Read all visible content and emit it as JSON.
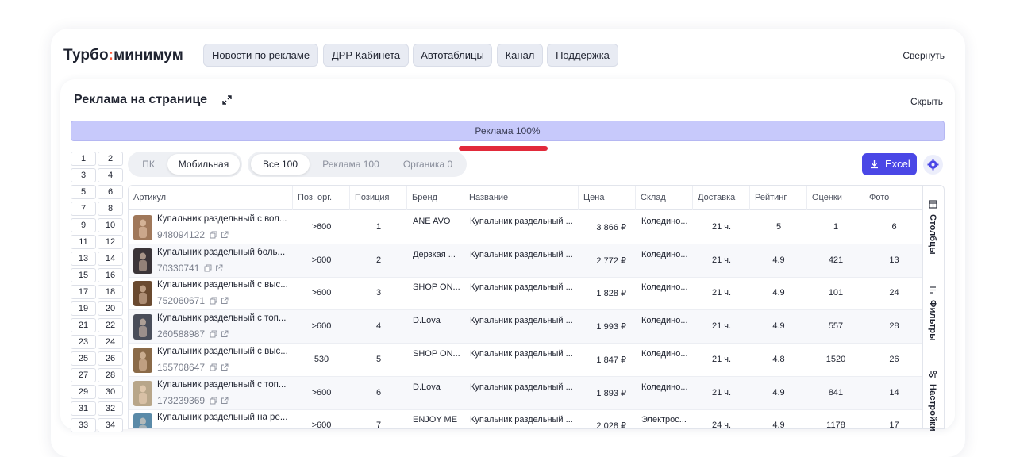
{
  "header": {
    "logo_part1": "Турбо",
    "logo_colon": ":",
    "logo_part2": "минимум",
    "nav": [
      "Новости по рекламе",
      "ДРР Кабинета",
      "Автотаблицы",
      "Канал",
      "Поддержка"
    ],
    "collapse_label": "Свернуть"
  },
  "section": {
    "title": "Реклама на странице",
    "hide_label": "Скрыть",
    "ad_bar_label": "Реклама 100%"
  },
  "positions": [
    "1",
    "2",
    "3",
    "4",
    "5",
    "6",
    "7",
    "8",
    "9",
    "10",
    "11",
    "12",
    "13",
    "14",
    "15",
    "16",
    "17",
    "18",
    "19",
    "20",
    "21",
    "22",
    "23",
    "24",
    "25",
    "26",
    "27",
    "28",
    "29",
    "30",
    "31",
    "32",
    "33",
    "34"
  ],
  "device_tabs": [
    {
      "label": "ПК",
      "active": false
    },
    {
      "label": "Мобильная",
      "active": true
    }
  ],
  "filter_tabs": [
    {
      "label": "Все 100",
      "active": true
    },
    {
      "label": "Реклама 100",
      "active": false
    },
    {
      "label": "Органика 0",
      "active": false
    }
  ],
  "excel_label": "Excel",
  "columns": [
    "Артикул",
    "Поз. орг.",
    "Позиция",
    "Бренд",
    "Название",
    "Цена",
    "Склад",
    "Доставка",
    "Рейтинг",
    "Оценки",
    "Фото"
  ],
  "rows": [
    {
      "name": "Купальник раздельный с вол...",
      "id": "948094122",
      "org": ">600",
      "pos": "1",
      "brand": "ANE AVO",
      "title": "Купальник раздельный ...",
      "price": "3 866 ₽",
      "stock": "Коледино...",
      "delivery": "21 ч.",
      "rating": "5",
      "reviews": "1",
      "photos": "6",
      "thumb_color": "#a0785a"
    },
    {
      "name": "Купальник раздельный боль...",
      "id": "70330741",
      "org": ">600",
      "pos": "2",
      "brand": "Дерзкая ...",
      "title": "Купальник раздельный ...",
      "price": "2 772 ₽",
      "stock": "Коледино...",
      "delivery": "21 ч.",
      "rating": "4.9",
      "reviews": "421",
      "photos": "13",
      "thumb_color": "#3a3438"
    },
    {
      "name": "Купальник раздельный с выс...",
      "id": "752060671",
      "org": ">600",
      "pos": "3",
      "brand": "SHOP ON...",
      "title": "Купальник раздельный ...",
      "price": "1 828 ₽",
      "stock": "Коледино...",
      "delivery": "21 ч.",
      "rating": "4.9",
      "reviews": "101",
      "photos": "24",
      "thumb_color": "#6a4a30"
    },
    {
      "name": "Купальник раздельный с топ...",
      "id": "260588987",
      "org": ">600",
      "pos": "4",
      "brand": "D.Lova",
      "title": "Купальник раздельный ...",
      "price": "1 993 ₽",
      "stock": "Коледино...",
      "delivery": "21 ч.",
      "rating": "4.9",
      "reviews": "557",
      "photos": "28",
      "thumb_color": "#4a4e5a"
    },
    {
      "name": "Купальник раздельный с выс...",
      "id": "155708647",
      "org": "530",
      "pos": "5",
      "brand": "SHOP ON...",
      "title": "Купальник раздельный ...",
      "price": "1 847 ₽",
      "stock": "Коледино...",
      "delivery": "21 ч.",
      "rating": "4.8",
      "reviews": "1520",
      "photos": "26",
      "thumb_color": "#8a6a48"
    },
    {
      "name": "Купальник раздельный с топ...",
      "id": "173239369",
      "org": ">600",
      "pos": "6",
      "brand": "D.Lova",
      "title": "Купальник раздельный ...",
      "price": "1 893 ₽",
      "stock": "Коледино...",
      "delivery": "21 ч.",
      "rating": "4.9",
      "reviews": "841",
      "photos": "14",
      "thumb_color": "#b8a68a"
    },
    {
      "name": "Купальник раздельный на ре...",
      "id": "",
      "org": ">600",
      "pos": "7",
      "brand": "ENJOY ME",
      "title": "Купальник раздельный ...",
      "price": "2 028 ₽",
      "stock": "Электрос...",
      "delivery": "24 ч.",
      "rating": "4.9",
      "reviews": "1178",
      "photos": "17",
      "thumb_color": "#5a8aa8"
    }
  ],
  "side_panel": [
    "Столбцы",
    "Фильтры",
    "Настройки"
  ]
}
